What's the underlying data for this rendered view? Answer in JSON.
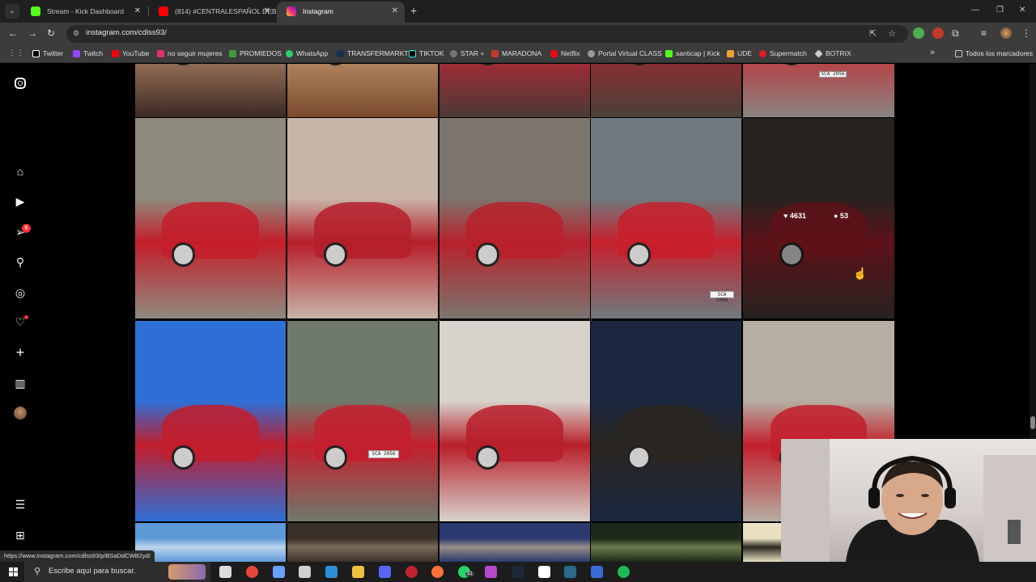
{
  "browser": {
    "tabs": [
      {
        "title": "Stream - Kick Dashboard",
        "active": false,
        "favicon_color": "#53fc18"
      },
      {
        "title": "(814) #CENTRALESPAÑOL DEBUT",
        "active": false,
        "favicon_color": "#ff0000"
      },
      {
        "title": "Instagram",
        "active": true,
        "favicon_color": "#e1306c"
      }
    ],
    "url": "instagram.com/cdlss93/",
    "bookmarks": [
      {
        "label": "Twitter",
        "color": "#ffffff"
      },
      {
        "label": "Twitch",
        "color": "#9146ff"
      },
      {
        "label": "YouTube",
        "color": "#ff0000"
      },
      {
        "label": "no seguir mujeres",
        "color": "#e1306c"
      },
      {
        "label": "PROMIEDOS",
        "color": "#3a9d3a"
      },
      {
        "label": "WhatsApp",
        "color": "#25d366"
      },
      {
        "label": "TRANSFERMARKT",
        "color": "#1a3151"
      },
      {
        "label": "TIKTOK",
        "color": "#ffffff"
      },
      {
        "label": "STAR +",
        "color": "#888888"
      },
      {
        "label": "MARADONA",
        "color": "#c0392b"
      },
      {
        "label": "Netflix",
        "color": "#e50914"
      },
      {
        "label": "Portal Virtual CLASS",
        "color": "#aaaaaa"
      },
      {
        "label": "santicap | Kick",
        "color": "#53fc18"
      },
      {
        "label": "UDE",
        "color": "#f0a030"
      },
      {
        "label": "Supermatch",
        "color": "#e31b23"
      },
      {
        "label": "BOTRIX",
        "color": "#cccccc"
      }
    ],
    "all_bookmarks": "Todos los marcadores",
    "status_url": "https://www.instagram.com/cdlss93/p/BSaDdCWB2yd/"
  },
  "instagram": {
    "nav_icons": [
      "instagram-logo-icon",
      "home-icon",
      "reels-icon",
      "messages-icon",
      "search-icon",
      "explore-icon",
      "notifications-icon",
      "create-icon",
      "dashboard-icon",
      "profile-avatar",
      "menu-icon",
      "threads-icon"
    ],
    "messages_badge": "6",
    "hover_post": {
      "likes": "4631",
      "comments": "53"
    },
    "posts": [
      {
        "desc": "red BMW wheel close-up on cobblestone",
        "c1": "#3b2a22",
        "c2": "#b8886a"
      },
      {
        "desc": "red car on wooden deck",
        "c1": "#7a4a2c",
        "c2": "#c49a74"
      },
      {
        "desc": "red car wheel",
        "c1": "#4a3a35",
        "c2": "#c22535"
      },
      {
        "desc": "red car on cobblestone",
        "c1": "#4a3f38",
        "c2": "#a02a2e"
      },
      {
        "desc": "BMW rear with plate SCA 2056",
        "c1": "#8a8580",
        "c2": "#c52a33"
      },
      {
        "desc": "red BMW 2002 beside stone wall with cannon",
        "c1": "#8f8a7e",
        "c2": "#c41e2a"
      },
      {
        "desc": "BMW engine bay",
        "c1": "#c8b4a8",
        "c2": "#b51e2a"
      },
      {
        "desc": "red BMW 2002 front",
        "c1": "#7c756e",
        "c2": "#b8212c"
      },
      {
        "desc": "red BMW rear near brick wall",
        "c1": "#6e7a80",
        "c2": "#c8202c"
      },
      {
        "desc": "red BMW with hood open",
        "c1": "#3d3530",
        "c2": "#8f1c26"
      },
      {
        "desc": "couple inside red car",
        "c1": "#2e6fd6",
        "c2": "#c21d2b"
      },
      {
        "desc": "red BMW rear in street",
        "c1": "#6f7a6a",
        "c2": "#c41f2e"
      },
      {
        "desc": "couple in front of red car",
        "c1": "#d8d2cc",
        "c2": "#b81f2a"
      },
      {
        "desc": "black car at night harbor",
        "c1": "#1b2740",
        "c2": "#2a2620"
      },
      {
        "desc": "red BMW in garage",
        "c1": "#b6aea2",
        "c2": "#c21e2b"
      },
      {
        "desc": "sky",
        "c1": "#5e9ad8",
        "c2": "#bcd4ec"
      },
      {
        "desc": "street buildings",
        "c1": "#3a2f28",
        "c2": "#7a6a5a"
      },
      {
        "desc": "storefront sign",
        "c1": "#2a3a70",
        "c2": "#9a8e88"
      },
      {
        "desc": "trees",
        "c1": "#1d2a1a",
        "c2": "#6a7a4a"
      },
      {
        "desc": "light",
        "c1": "#e8e0c0",
        "c2": "#2a2a20"
      }
    ]
  },
  "taskbar": {
    "search_placeholder": "Escribe aquí para buscar.",
    "icons": [
      {
        "name": "task-view-icon",
        "color": "#dddddd"
      },
      {
        "name": "chrome-icon",
        "color": "#e8453c"
      },
      {
        "name": "copilot-icon",
        "color": "#6aa0ff"
      },
      {
        "name": "obs-icon",
        "color": "#cfcfcf"
      },
      {
        "name": "edge-icon",
        "color": "#2a8fd4"
      },
      {
        "name": "file-explorer-icon",
        "color": "#f0c040"
      },
      {
        "name": "discord-icon",
        "color": "#5865f2"
      },
      {
        "name": "opera-icon",
        "color": "#c0222e"
      },
      {
        "name": "firefox-icon",
        "color": "#ff7139"
      },
      {
        "name": "whatsapp-icon",
        "color": "#25d366"
      },
      {
        "name": "app-icon",
        "color": "#b44ac8"
      },
      {
        "name": "steam-icon",
        "color": "#1b2838"
      },
      {
        "name": "capcut-icon",
        "color": "#ffffff"
      },
      {
        "name": "app2-icon",
        "color": "#2a6a8a"
      },
      {
        "name": "vpn-icon",
        "color": "#3a6ad8"
      },
      {
        "name": "spotify-icon",
        "color": "#1db954"
      }
    ],
    "whatsapp_count": "51"
  },
  "plates": [
    "SCA 2056",
    "SCA 2056",
    "SCA 2056"
  ]
}
